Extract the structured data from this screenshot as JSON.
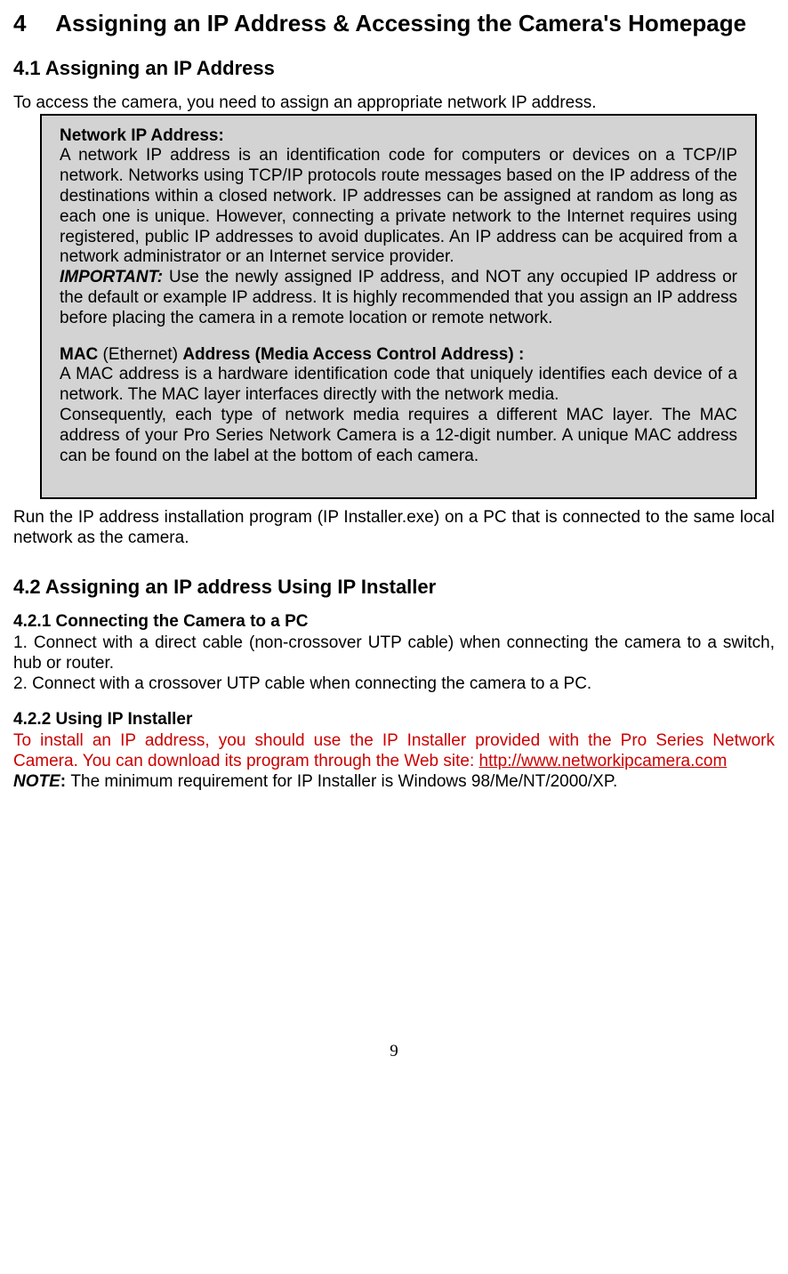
{
  "chapter": {
    "number": "4",
    "title": "Assigning an IP Address & Accessing the Camera's Homepage"
  },
  "section_4_1": {
    "heading": "4.1 Assigning an IP Address",
    "intro": "To access the camera, you need to assign an appropriate network IP address."
  },
  "info_box": {
    "ip_title": "Network IP Address:",
    "ip_body": "A network IP address is an identification code for computers or devices on a TCP/IP network. Networks using TCP/IP protocols route messages based on the IP address of the destinations within a closed network. IP addresses can be assigned at random as long as each one is unique. However, connecting a private network to the Internet requires using registered, public IP addresses to avoid duplicates. An IP address can be acquired from a network administrator or an Internet service provider.",
    "important_label": "IMPORTANT:",
    "important_body": " Use the newly assigned IP address, and NOT any occupied IP address or the default or example IP address. It is highly recommended that you assign an IP address before placing the camera in a remote location or remote network.",
    "mac_title_prefix": "MAC",
    "mac_title_mid": " (Ethernet) ",
    "mac_title_suffix": "Address (Media Access Control Address) :",
    "mac_body1": "A MAC address is a hardware identification code that uniquely identifies each device of a network. The MAC layer interfaces directly with the network media.",
    "mac_body2": "Consequently, each type of network media requires a different MAC layer. The MAC address of your Pro Series Network Camera is a 12-digit number. A unique MAC address can be found on the label at the bottom of each camera."
  },
  "post_box": "Run the IP address installation program (IP Installer.exe) on a PC that is connected to the same local network as the camera.",
  "section_4_2": {
    "heading": "4.2 Assigning an IP address Using IP Installer"
  },
  "section_4_2_1": {
    "heading": "4.2.1 Connecting the Camera to a PC",
    "item1": "1. Connect with a direct cable (non-crossover UTP cable) when connecting the camera to a switch, hub or router.",
    "item2": "2. Connect with a crossover UTP cable when connecting the camera to a PC."
  },
  "section_4_2_2": {
    "heading": "4.2.2 Using IP Installer",
    "body_pre_link": "To install an IP address, you should use the IP Installer provided with the Pro Series Network Camera. You can download its program through the Web site: ",
    "link": "http://www.networkipcamera.com",
    "note_label": "NOTE",
    "note_colon": ": ",
    "note_body": "The minimum requirement for IP Installer is Windows 98/Me/NT/2000/XP."
  },
  "page_number": "9"
}
